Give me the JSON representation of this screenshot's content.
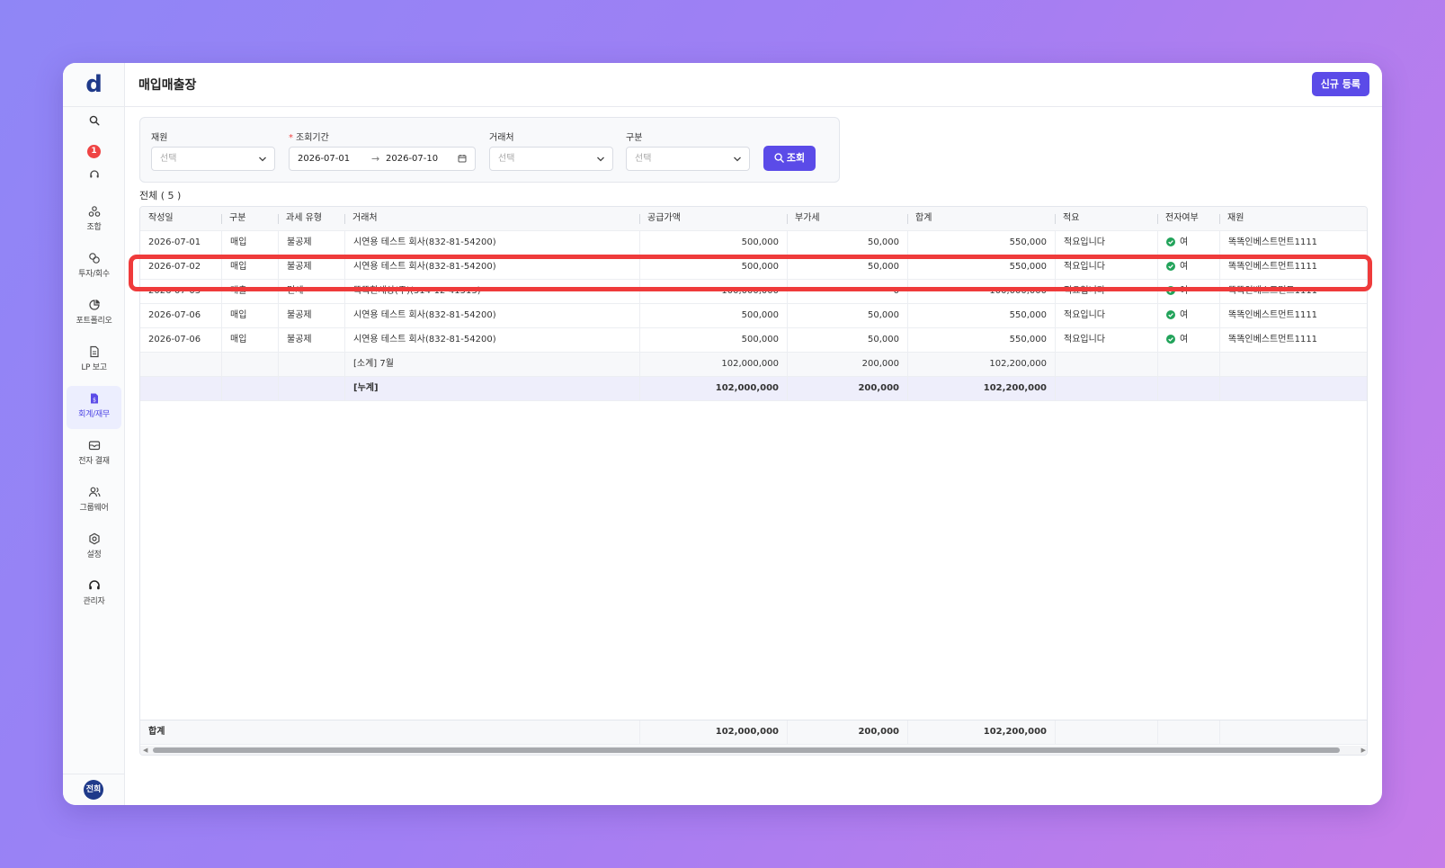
{
  "app": {
    "logo": "d",
    "notification_count": "1",
    "user_avatar": "전희"
  },
  "sidebar": {
    "items": [
      {
        "label": "조합",
        "icon": "union-icon"
      },
      {
        "label": "투자/회수",
        "icon": "invest-icon"
      },
      {
        "label": "포트폴리오",
        "icon": "portfolio-icon"
      },
      {
        "label": "LP 보고",
        "icon": "report-icon"
      },
      {
        "label": "회계/재무",
        "icon": "accounting-icon",
        "active": true
      },
      {
        "label": "전자 결재",
        "icon": "approval-icon"
      },
      {
        "label": "그룹웨어",
        "icon": "groupware-icon"
      },
      {
        "label": "설정",
        "icon": "settings-icon"
      },
      {
        "label": "관리자",
        "icon": "admin-icon"
      }
    ]
  },
  "header": {
    "title": "매입매출장",
    "new_button": "신규 등록"
  },
  "filters": {
    "fund": {
      "label": "재원",
      "value": "선택"
    },
    "period": {
      "label": "조회기간",
      "start": "2026-07-01",
      "end": "2026-07-10"
    },
    "partner": {
      "label": "거래처",
      "value": "선택"
    },
    "category": {
      "label": "구분",
      "value": "선택"
    },
    "search_button": "조회"
  },
  "total_label": "전체 ( 5 )",
  "table": {
    "columns": [
      "작성일",
      "구분",
      "과세 유형",
      "거래처",
      "공급가액",
      "부가세",
      "합계",
      "적요",
      "전자여부",
      "재원"
    ],
    "rows": [
      [
        "2026-07-01",
        "매입",
        "불공제",
        "시연용 테스트 회사(832-81-54200)",
        "500,000",
        "50,000",
        "550,000",
        "적요입니다",
        "여",
        "똑똑인베스트먼트1111"
      ],
      [
        "2026-07-02",
        "매입",
        "불공제",
        "시연용 테스트 회사(832-81-54200)",
        "500,000",
        "50,000",
        "550,000",
        "적요입니다",
        "여",
        "똑똑인베스트먼트1111"
      ],
      [
        "2026-07-03",
        "매출",
        "면세",
        "똑똑한세상(주)(314-12-41513)",
        "100,000,000",
        "0",
        "100,000,000",
        "적요입니다",
        "여",
        "똑똑인베스트먼트1111"
      ],
      [
        "2026-07-06",
        "매입",
        "불공제",
        "시연용 테스트 회사(832-81-54200)",
        "500,000",
        "50,000",
        "550,000",
        "적요입니다",
        "여",
        "똑똑인베스트먼트1111"
      ],
      [
        "2026-07-06",
        "매입",
        "불공제",
        "시연용 테스트 회사(832-81-54200)",
        "500,000",
        "50,000",
        "550,000",
        "적요입니다",
        "여",
        "똑똑인베스트먼트1111"
      ]
    ],
    "subtotal": {
      "label": "[소계] 7월",
      "supply": "102,000,000",
      "vat": "200,000",
      "total": "102,200,000"
    },
    "cumulative": {
      "label": "[누계]",
      "supply": "102,000,000",
      "vat": "200,000",
      "total": "102,200,000"
    },
    "footer": {
      "label": "합계",
      "supply": "102,000,000",
      "vat": "200,000",
      "total": "102,200,000"
    }
  },
  "colors": {
    "accent": "#5b4be8",
    "highlight": "#ef3b3b",
    "ok": "#22a35a"
  }
}
